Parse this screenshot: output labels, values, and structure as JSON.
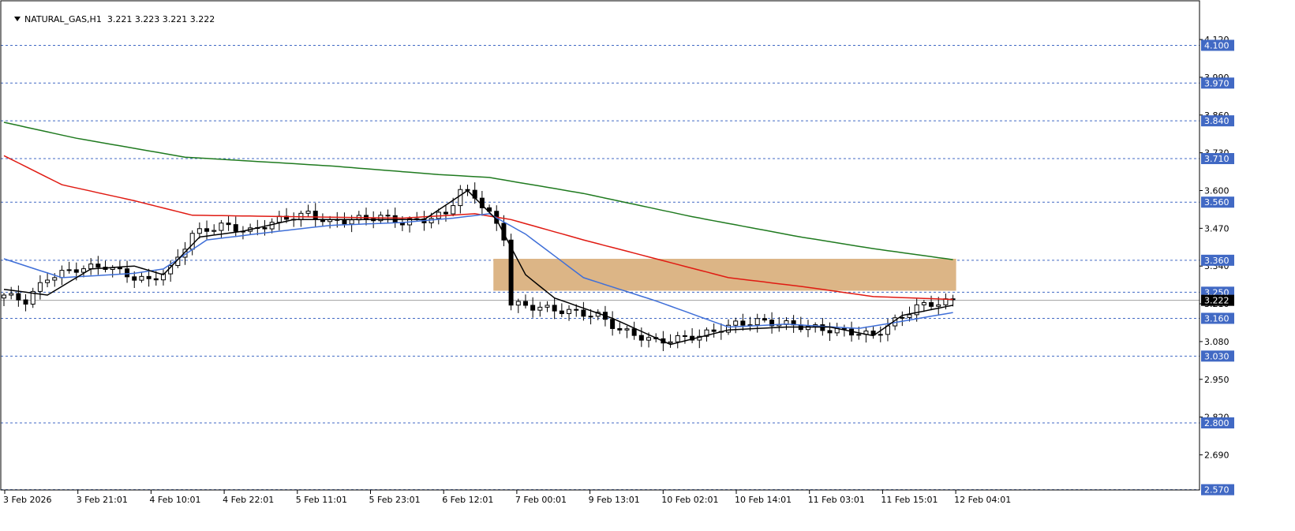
{
  "header": {
    "symbol_label": "NATURAL_GAS,H1",
    "ohlc_label": "3.221 3.223 3.221 3.222"
  },
  "colors": {
    "background": "#ffffff",
    "axis": "#000000",
    "level_line": "#4169c4",
    "level_label_bg": "#4169c4",
    "level_label_text": "#ffffff",
    "price_line": "#a0a0a0",
    "zone_fill": "#dcb586",
    "ma_green": "#1f7a1f",
    "ma_red": "#e01a12",
    "ma_blue": "#3f6fd8",
    "ma_black": "#000000"
  },
  "chart_data": {
    "type": "candlestick",
    "symbol": "NATURAL_GAS",
    "timeframe": "H1",
    "current_price": 3.222,
    "current_price_label": "3.222",
    "y_axis": {
      "ylim": [
        2.55,
        4.18
      ],
      "ticks": [
        "4.120",
        "3.990",
        "3.860",
        "3.730",
        "3.600",
        "3.470",
        "3.340",
        "3.210",
        "3.080",
        "2.950",
        "2.820",
        "2.690"
      ]
    },
    "x_axis": {
      "ticks": [
        "3 Feb 2026",
        "3 Feb 21:01",
        "4 Feb 10:01",
        "4 Feb 22:01",
        "5 Feb 11:01",
        "5 Feb 23:01",
        "6 Feb 12:01",
        "7 Feb 00:01",
        "9 Feb 13:01",
        "10 Feb 02:01",
        "10 Feb 14:01",
        "11 Feb 03:01",
        "11 Feb 15:01",
        "12 Feb 04:01"
      ]
    },
    "levels": [
      {
        "value": 4.1,
        "label": "4.100"
      },
      {
        "value": 3.97,
        "label": "3.970"
      },
      {
        "value": 3.84,
        "label": "3.840"
      },
      {
        "value": 3.71,
        "label": "3.710"
      },
      {
        "value": 3.56,
        "label": "3.560"
      },
      {
        "value": 3.36,
        "label": "3.360"
      },
      {
        "value": 3.25,
        "label": "3.250"
      },
      {
        "value": 3.16,
        "label": "3.160"
      },
      {
        "value": 3.03,
        "label": "3.030"
      },
      {
        "value": 2.8,
        "label": "2.800"
      },
      {
        "value": 2.57,
        "label": "2.570"
      }
    ],
    "zone": {
      "low": 3.255,
      "high": 3.365,
      "from_bar": 68,
      "to_bar": 131
    },
    "ma_green_keys": [
      [
        0,
        3.835
      ],
      [
        10,
        3.78
      ],
      [
        25,
        3.715
      ],
      [
        45,
        3.685
      ],
      [
        60,
        3.655
      ],
      [
        67,
        3.645
      ],
      [
        80,
        3.59
      ],
      [
        95,
        3.51
      ],
      [
        110,
        3.44
      ],
      [
        120,
        3.4
      ],
      [
        131,
        3.362
      ]
    ],
    "ma_red_keys": [
      [
        0,
        3.72
      ],
      [
        8,
        3.62
      ],
      [
        18,
        3.565
      ],
      [
        26,
        3.515
      ],
      [
        40,
        3.51
      ],
      [
        55,
        3.505
      ],
      [
        65,
        3.52
      ],
      [
        70,
        3.5
      ],
      [
        80,
        3.43
      ],
      [
        100,
        3.3
      ],
      [
        110,
        3.27
      ],
      [
        120,
        3.235
      ],
      [
        131,
        3.225
      ]
    ],
    "ma_blue_keys": [
      [
        0,
        3.365
      ],
      [
        8,
        3.3
      ],
      [
        18,
        3.315
      ],
      [
        22,
        3.33
      ],
      [
        28,
        3.43
      ],
      [
        38,
        3.46
      ],
      [
        45,
        3.48
      ],
      [
        55,
        3.49
      ],
      [
        62,
        3.505
      ],
      [
        67,
        3.52
      ],
      [
        72,
        3.45
      ],
      [
        80,
        3.3
      ],
      [
        90,
        3.22
      ],
      [
        100,
        3.13
      ],
      [
        108,
        3.14
      ],
      [
        118,
        3.125
      ],
      [
        124,
        3.15
      ],
      [
        131,
        3.18
      ]
    ],
    "ma_black_keys": [
      [
        0,
        3.26
      ],
      [
        6,
        3.24
      ],
      [
        12,
        3.33
      ],
      [
        18,
        3.34
      ],
      [
        22,
        3.31
      ],
      [
        27,
        3.44
      ],
      [
        33,
        3.46
      ],
      [
        40,
        3.5
      ],
      [
        50,
        3.5
      ],
      [
        58,
        3.5
      ],
      [
        64,
        3.6
      ],
      [
        68,
        3.5
      ],
      [
        72,
        3.31
      ],
      [
        76,
        3.23
      ],
      [
        84,
        3.16
      ],
      [
        92,
        3.07
      ],
      [
        100,
        3.12
      ],
      [
        108,
        3.13
      ],
      [
        114,
        3.13
      ],
      [
        120,
        3.1
      ],
      [
        124,
        3.17
      ],
      [
        131,
        3.205
      ]
    ],
    "close_keys": [
      [
        0,
        3.24
      ],
      [
        3,
        3.22
      ],
      [
        6,
        3.3
      ],
      [
        10,
        3.33
      ],
      [
        14,
        3.34
      ],
      [
        18,
        3.3
      ],
      [
        20,
        3.29
      ],
      [
        23,
        3.33
      ],
      [
        26,
        3.45
      ],
      [
        30,
        3.48
      ],
      [
        34,
        3.46
      ],
      [
        38,
        3.5
      ],
      [
        42,
        3.52
      ],
      [
        45,
        3.49
      ],
      [
        48,
        3.5
      ],
      [
        52,
        3.51
      ],
      [
        55,
        3.49
      ],
      [
        58,
        3.5
      ],
      [
        61,
        3.52
      ],
      [
        63,
        3.6
      ],
      [
        65,
        3.58
      ],
      [
        67,
        3.52
      ],
      [
        69,
        3.44
      ],
      [
        70,
        3.21
      ],
      [
        76,
        3.19
      ],
      [
        82,
        3.17
      ],
      [
        85,
        3.12
      ],
      [
        90,
        3.08
      ],
      [
        96,
        3.1
      ],
      [
        101,
        3.14
      ],
      [
        104,
        3.15
      ],
      [
        108,
        3.14
      ],
      [
        114,
        3.12
      ],
      [
        118,
        3.11
      ],
      [
        120,
        3.1
      ],
      [
        123,
        3.15
      ],
      [
        126,
        3.2
      ],
      [
        128,
        3.21
      ],
      [
        131,
        3.22
      ]
    ],
    "bars": 132
  }
}
